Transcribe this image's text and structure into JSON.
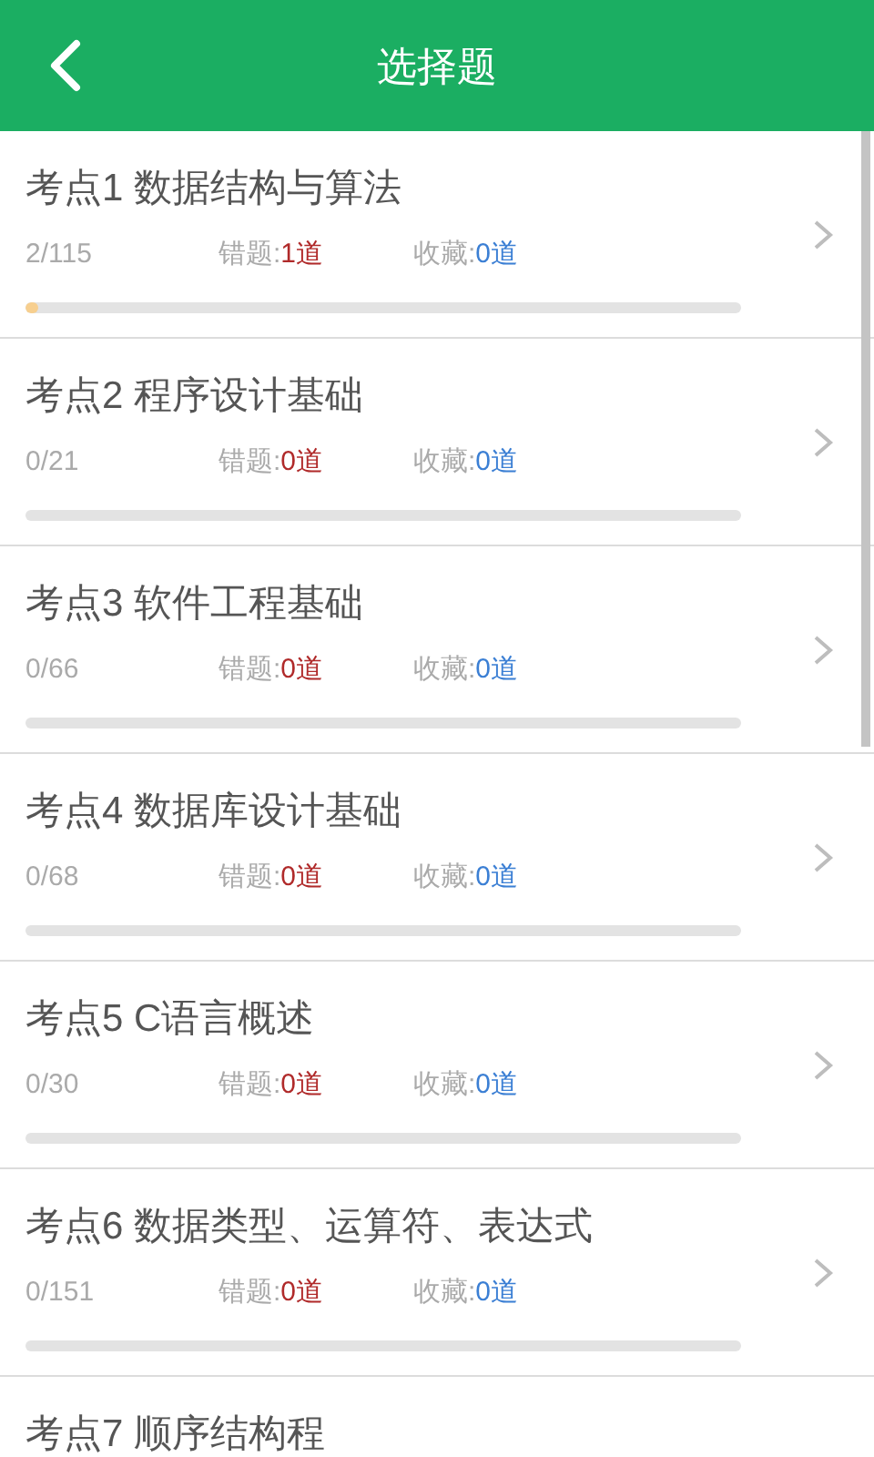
{
  "header": {
    "title": "选择题"
  },
  "items": [
    {
      "title": "考点1 数据结构与算法",
      "progress": "2/115",
      "wrong_label": "错题:",
      "wrong_count": "1道",
      "fav_label": "收藏:",
      "fav_count": "0道",
      "level": 0.017
    },
    {
      "title": "考点2 程序设计基础",
      "progress": "0/21",
      "wrong_label": "错题:",
      "wrong_count": "0道",
      "fav_label": "收藏:",
      "fav_count": "0道"
    },
    {
      "title": "考点3 软件工程基础",
      "progress": "0/66",
      "wrong_label": "错题:",
      "wrong_count": "0道",
      "fav_label": "收藏:",
      "fav_count": "0道"
    },
    {
      "title": "考点4 数据库设计基础",
      "progress": "0/68",
      "wrong_label": "错题:",
      "wrong_count": "0道",
      "fav_label": "收藏:",
      "fav_count": "0道"
    },
    {
      "title": "考点5 C语言概述",
      "progress": "0/30",
      "wrong_label": "错题:",
      "wrong_count": "0道",
      "fav_label": "收藏:",
      "fav_count": "0道"
    },
    {
      "title": "考点6 数据类型、运算符、表达式",
      "progress": "0/151",
      "wrong_label": "错题:",
      "wrong_count": "0道",
      "fav_label": "收藏:",
      "fav_count": "0道"
    },
    {
      "title": "考点7 顺序结构程"
    }
  ]
}
